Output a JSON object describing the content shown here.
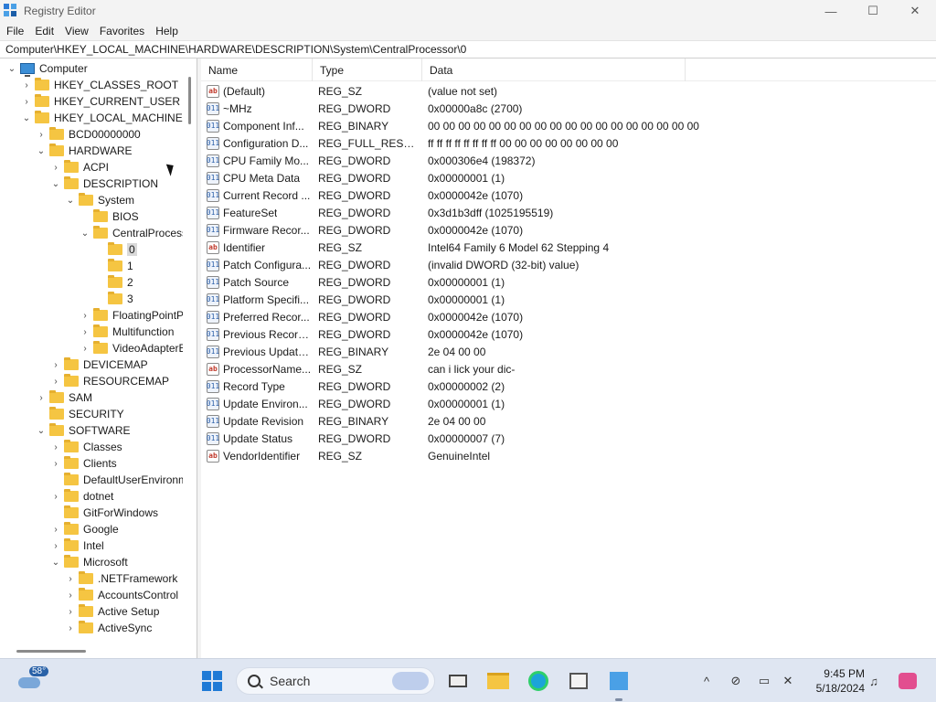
{
  "window": {
    "title": "Registry Editor",
    "controls": {
      "minimize": "—",
      "maximize": "☐",
      "close": "✕"
    }
  },
  "menu": [
    "File",
    "Edit",
    "View",
    "Favorites",
    "Help"
  ],
  "address": "Computer\\HKEY_LOCAL_MACHINE\\HARDWARE\\DESCRIPTION\\System\\CentralProcessor\\0",
  "tree": [
    {
      "label": "Computer",
      "level": 0,
      "expanded": true,
      "icon": "computer-icon"
    },
    {
      "label": "HKEY_CLASSES_ROOT",
      "level": 1,
      "expanded": false
    },
    {
      "label": "HKEY_CURRENT_USER",
      "level": 1,
      "expanded": false
    },
    {
      "label": "HKEY_LOCAL_MACHINE",
      "level": 1,
      "expanded": true
    },
    {
      "label": "BCD00000000",
      "level": 2,
      "expanded": false
    },
    {
      "label": "HARDWARE",
      "level": 2,
      "expanded": true
    },
    {
      "label": "ACPI",
      "level": 3,
      "expanded": false
    },
    {
      "label": "DESCRIPTION",
      "level": 3,
      "expanded": true
    },
    {
      "label": "System",
      "level": 4,
      "expanded": true
    },
    {
      "label": "BIOS",
      "level": 5,
      "expanded": null
    },
    {
      "label": "CentralProcess",
      "level": 5,
      "expanded": true
    },
    {
      "label": "0",
      "level": 6,
      "expanded": null,
      "selected": true
    },
    {
      "label": "1",
      "level": 6,
      "expanded": null
    },
    {
      "label": "2",
      "level": 6,
      "expanded": null
    },
    {
      "label": "3",
      "level": 6,
      "expanded": null
    },
    {
      "label": "FloatingPointP",
      "level": 5,
      "expanded": false
    },
    {
      "label": "Multifunction",
      "level": 5,
      "expanded": false
    },
    {
      "label": "VideoAdapterB",
      "level": 5,
      "expanded": false
    },
    {
      "label": "DEVICEMAP",
      "level": 3,
      "expanded": false
    },
    {
      "label": "RESOURCEMAP",
      "level": 3,
      "expanded": false
    },
    {
      "label": "SAM",
      "level": 2,
      "expanded": false
    },
    {
      "label": "SECURITY",
      "level": 2,
      "expanded": null
    },
    {
      "label": "SOFTWARE",
      "level": 2,
      "expanded": true
    },
    {
      "label": "Classes",
      "level": 3,
      "expanded": false
    },
    {
      "label": "Clients",
      "level": 3,
      "expanded": false
    },
    {
      "label": "DefaultUserEnvironm",
      "level": 3,
      "expanded": null
    },
    {
      "label": "dotnet",
      "level": 3,
      "expanded": false
    },
    {
      "label": "GitForWindows",
      "level": 3,
      "expanded": null
    },
    {
      "label": "Google",
      "level": 3,
      "expanded": false
    },
    {
      "label": "Intel",
      "level": 3,
      "expanded": false
    },
    {
      "label": "Microsoft",
      "level": 3,
      "expanded": true
    },
    {
      "label": ".NETFramework",
      "level": 4,
      "expanded": false
    },
    {
      "label": "AccountsControl",
      "level": 4,
      "expanded": false
    },
    {
      "label": "Active Setup",
      "level": 4,
      "expanded": false
    },
    {
      "label": "ActiveSync",
      "level": 4,
      "expanded": false
    }
  ],
  "columns": [
    "Name",
    "Type",
    "Data"
  ],
  "values": [
    {
      "name": "(Default)",
      "type": "REG_SZ",
      "data": "(value not set)",
      "kind": "sz"
    },
    {
      "name": "~MHz",
      "type": "REG_DWORD",
      "data": "0x00000a8c (2700)",
      "kind": "bin"
    },
    {
      "name": "Component Inf...",
      "type": "REG_BINARY",
      "data": "00 00 00 00 00 00 00 00 00 00 00 00 00 00 00 00 00 00",
      "kind": "bin"
    },
    {
      "name": "Configuration D...",
      "type": "REG_FULL_RESOU...",
      "data": "ff ff ff ff ff ff ff ff 00 00 00 00 00 00 00 00",
      "kind": "bin"
    },
    {
      "name": "CPU Family Mo...",
      "type": "REG_DWORD",
      "data": "0x000306e4 (198372)",
      "kind": "bin"
    },
    {
      "name": "CPU Meta Data",
      "type": "REG_DWORD",
      "data": "0x00000001 (1)",
      "kind": "bin"
    },
    {
      "name": "Current Record ...",
      "type": "REG_DWORD",
      "data": "0x0000042e (1070)",
      "kind": "bin"
    },
    {
      "name": "FeatureSet",
      "type": "REG_DWORD",
      "data": "0x3d1b3dff (1025195519)",
      "kind": "bin"
    },
    {
      "name": "Firmware Recor...",
      "type": "REG_DWORD",
      "data": "0x0000042e (1070)",
      "kind": "bin"
    },
    {
      "name": "Identifier",
      "type": "REG_SZ",
      "data": "Intel64 Family 6 Model 62 Stepping 4",
      "kind": "sz"
    },
    {
      "name": "Patch Configura...",
      "type": "REG_DWORD",
      "data": "(invalid DWORD (32-bit) value)",
      "kind": "bin"
    },
    {
      "name": "Patch Source",
      "type": "REG_DWORD",
      "data": "0x00000001 (1)",
      "kind": "bin"
    },
    {
      "name": "Platform Specifi...",
      "type": "REG_DWORD",
      "data": "0x00000001 (1)",
      "kind": "bin"
    },
    {
      "name": "Preferred Recor...",
      "type": "REG_DWORD",
      "data": "0x0000042e (1070)",
      "kind": "bin"
    },
    {
      "name": "Previous Record...",
      "type": "REG_DWORD",
      "data": "0x0000042e (1070)",
      "kind": "bin"
    },
    {
      "name": "Previous Update...",
      "type": "REG_BINARY",
      "data": "2e 04 00 00",
      "kind": "bin"
    },
    {
      "name": "ProcessorName...",
      "type": "REG_SZ",
      "data": "can i lick your dic-",
      "kind": "sz"
    },
    {
      "name": "Record Type",
      "type": "REG_DWORD",
      "data": "0x00000002 (2)",
      "kind": "bin"
    },
    {
      "name": "Update Environ...",
      "type": "REG_DWORD",
      "data": "0x00000001 (1)",
      "kind": "bin"
    },
    {
      "name": "Update Revision",
      "type": "REG_BINARY",
      "data": "2e 04 00 00",
      "kind": "bin"
    },
    {
      "name": "Update Status",
      "type": "REG_DWORD",
      "data": "0x00000007 (7)",
      "kind": "bin"
    },
    {
      "name": "VendorIdentifier",
      "type": "REG_SZ",
      "data": "GenuineIntel",
      "kind": "sz"
    }
  ],
  "taskbar": {
    "weather_temp": "58°",
    "search_label": "Search",
    "apps": [
      "task-view-icon",
      "file-explorer-icon",
      "edge-icon",
      "store-icon",
      "registry-editor-icon"
    ],
    "time": "9:45 PM",
    "date": "5/18/2024"
  }
}
